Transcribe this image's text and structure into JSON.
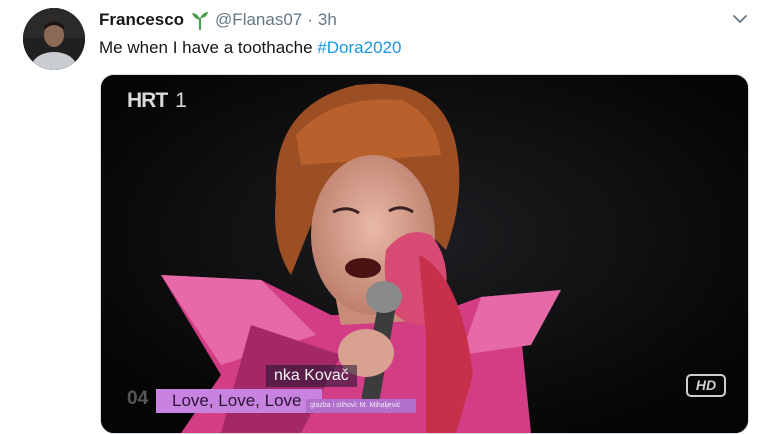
{
  "tweet": {
    "author": {
      "display_name": "Francesco",
      "badge_icon": "sprout-icon",
      "handle": "@Flanas07",
      "separator": "·",
      "time": "3h"
    },
    "text": "Me when I have a toothache",
    "hashtag": "#Dora2020",
    "menu_icon": "chevron-down-icon"
  },
  "media": {
    "channel_logo": "HRT",
    "channel_number": "1",
    "performer_name_partial": "nka Kovač",
    "number_partial": "04",
    "song_title": "Love, Love, Love",
    "credits": "glazba i stihovi: M. Mihaljević",
    "hd_badge": "HD"
  },
  "colors": {
    "hashtag": "#1b95e0",
    "secondary_text": "#657786",
    "primary_text": "#14171a",
    "sprout_green": "#4aa04a",
    "song_bar": "#c882df"
  }
}
